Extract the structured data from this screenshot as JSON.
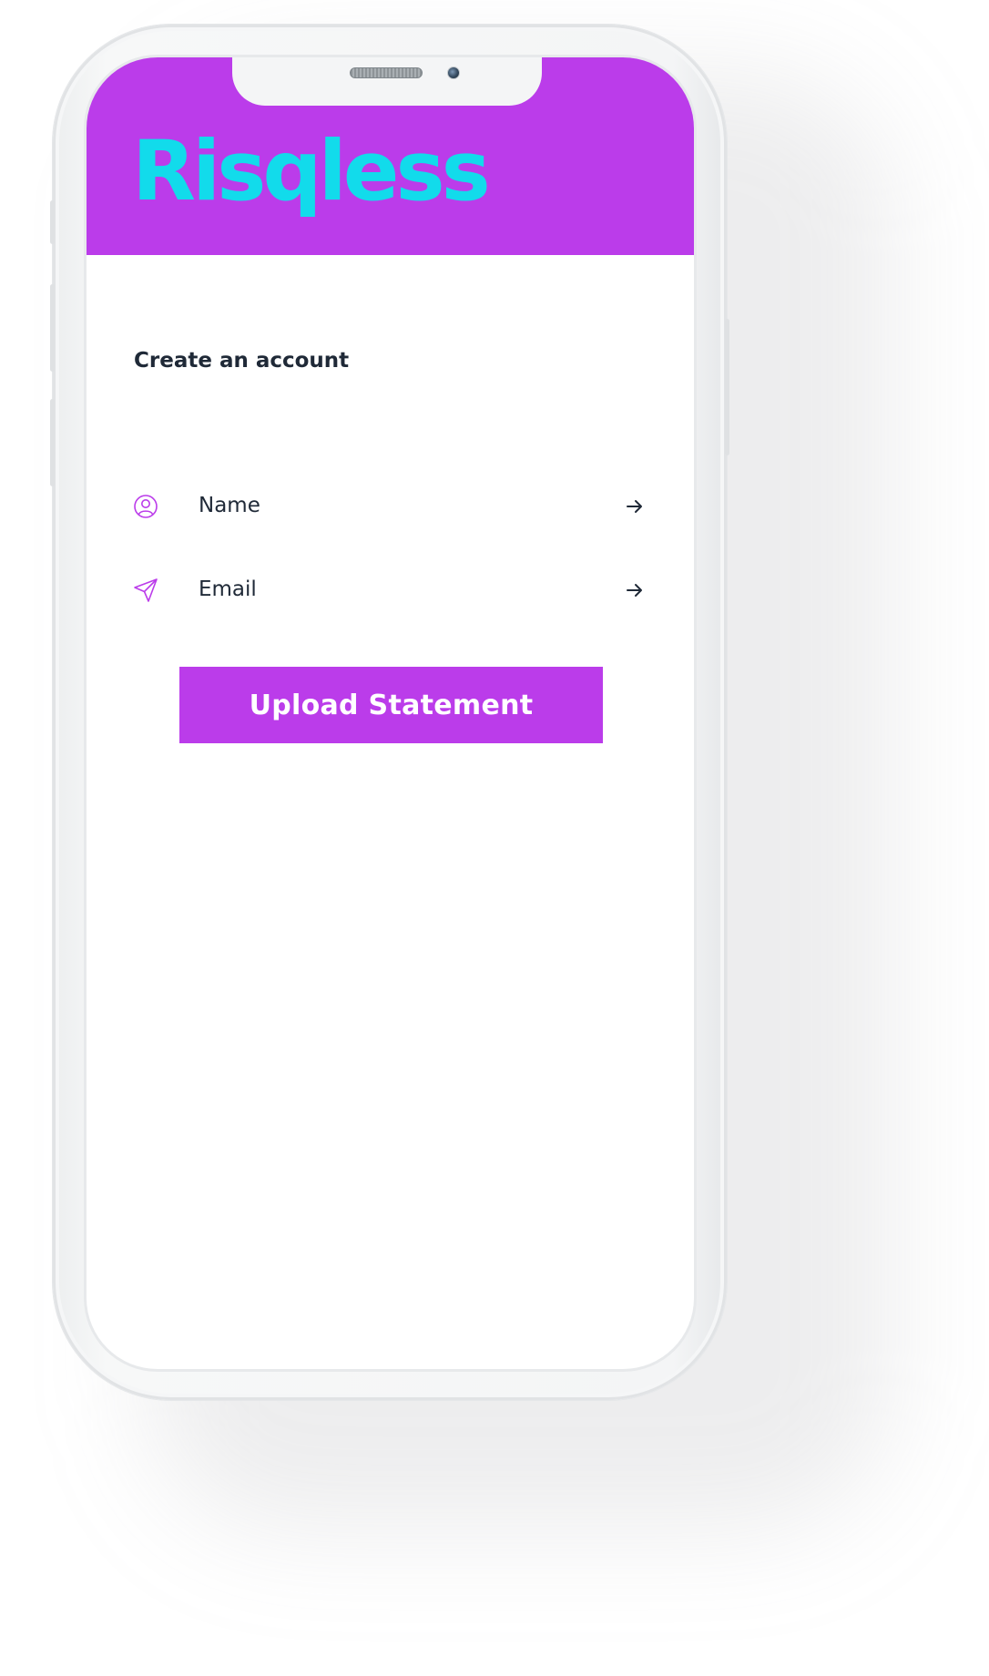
{
  "app": {
    "brand": "Risqless",
    "brand_color": "#12dbeb",
    "accent": "#bb3cea"
  },
  "form": {
    "title": "Create an account",
    "fields": [
      {
        "label": "Name",
        "icon": "user-circle-icon",
        "action_icon": "arrow-right-icon"
      },
      {
        "label": "Email",
        "icon": "send-icon",
        "action_icon": "arrow-right-icon"
      }
    ],
    "submit_label": "Upload Statement"
  }
}
